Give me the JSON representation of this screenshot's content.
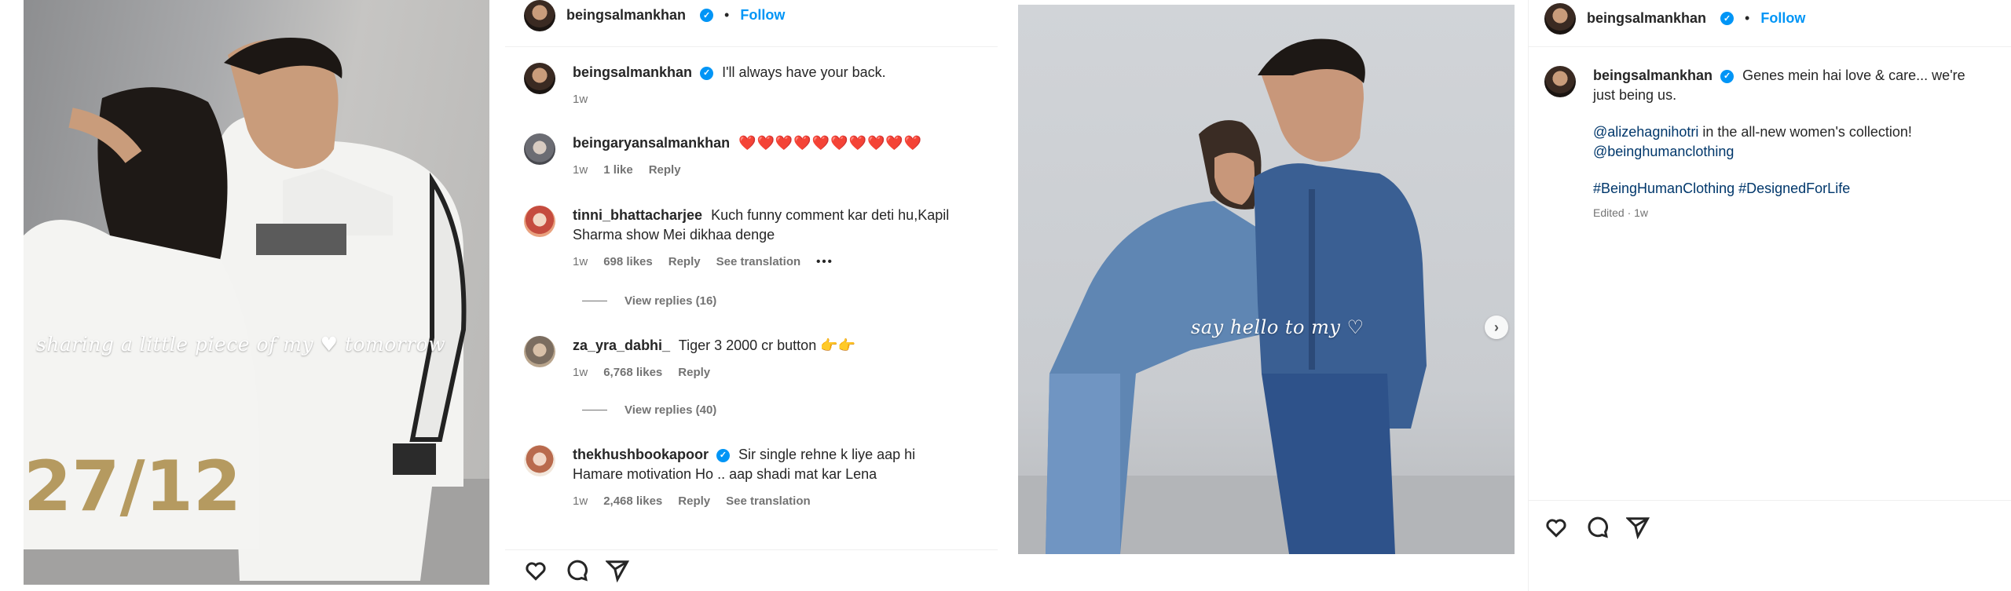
{
  "colors": {
    "accent": "#0095f6",
    "link": "#00376b",
    "heart": "#ed1c3a",
    "meta": "#737373"
  },
  "post1": {
    "header": {
      "username": "beingsalmankhan",
      "separator": "•",
      "follow": "Follow"
    },
    "overlay_text": "sharing a little piece of my ♥ tomorrow",
    "caption": {
      "username": "beingsalmankhan",
      "text": "I'll always have your back.",
      "time": "1w"
    },
    "comments": [
      {
        "username": "beingaryansalmankhan",
        "text": "❤️❤️❤️❤️❤️❤️❤️❤️❤️❤️",
        "time": "1w",
        "likes": "1 like",
        "reply": "Reply"
      },
      {
        "username": "tinni_bhattacharjee",
        "text": "Kuch funny comment kar deti hu,Kapil Sharma show Mei dikhaa denge",
        "time": "1w",
        "likes": "698 likes",
        "reply": "Reply",
        "translate": "See translation",
        "more": "•••",
        "view_replies": "View replies (16)"
      },
      {
        "username": "za_yra_dabhi_",
        "text": "Tiger 3 2000 cr button 👉👉",
        "time": "1w",
        "likes": "6,768 likes",
        "reply": "Reply",
        "view_replies": "View replies (40)"
      },
      {
        "username": "thekhushbookapoor",
        "text": "Sir single rehne k liye aap hi Hamare motivation Ho .. aap shadi mat kar Lena",
        "time": "1w",
        "likes": "2,468 likes",
        "reply": "Reply",
        "translate": "See translation"
      }
    ],
    "actions": {
      "like": "heart-icon",
      "comment": "comment-icon",
      "share": "share-icon"
    }
  },
  "post2": {
    "header": {
      "username": "beingsalmankhan",
      "separator": "•",
      "follow": "Follow"
    },
    "overlay_text": "say hello to my ♡",
    "caption": {
      "username": "beingsalmankhan",
      "text": "Genes mein hai love & care... we're just being us.",
      "mention_line": "@alizehagnihotri",
      "mention_text": " in the all-new women's collection!",
      "mention2": "@beinghumanclothing",
      "hashtags": "#BeingHumanClothing #DesignedForLife",
      "edited": "Edited · 1w"
    },
    "actions": {
      "like": "heart-icon",
      "comment": "comment-icon",
      "share": "share-icon"
    }
  }
}
